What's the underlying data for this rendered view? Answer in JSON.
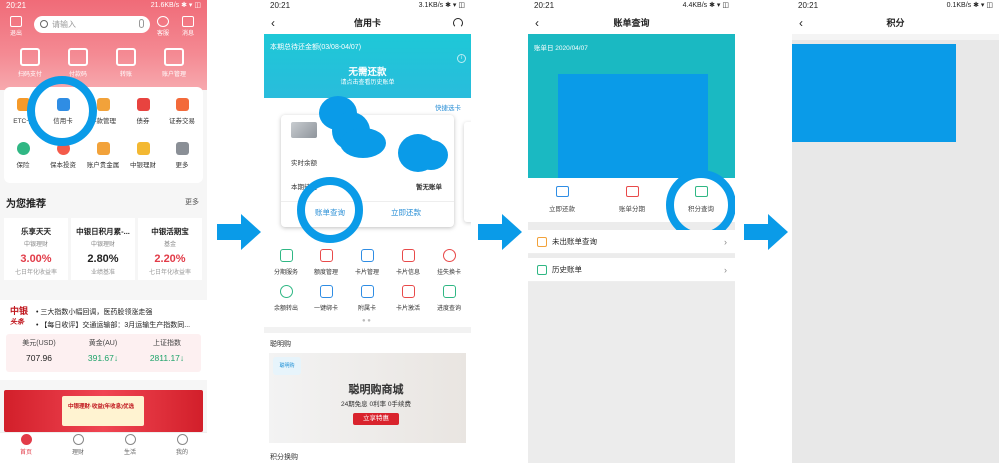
{
  "screen1": {
    "status": {
      "time": "20:21",
      "right": "21.6KB/s ✱ ▾ ◫"
    },
    "top_icons": [
      {
        "label": "退出"
      },
      {
        "label": "客服"
      },
      {
        "label": "消息"
      }
    ],
    "search_placeholder": "请输入",
    "quick": [
      {
        "label": "扫码支付"
      },
      {
        "label": "付款码"
      },
      {
        "label": "转账"
      },
      {
        "label": "账户管理"
      }
    ],
    "menu": [
      {
        "label": "ETC卡",
        "color": "#f59a2a"
      },
      {
        "label": "信用卡",
        "color": "#2f8de4"
      },
      {
        "label": "存款管理",
        "color": "#f2a23a"
      },
      {
        "label": "债券",
        "color": "#e8433f"
      },
      {
        "label": "证券交易",
        "color": "#f36a3a"
      },
      {
        "label": "保险",
        "color": "#30b784"
      },
      {
        "label": "保本投资",
        "color": "#f45a4a"
      },
      {
        "label": "账户贵金属",
        "color": "#f2a23a"
      },
      {
        "label": "中银理财",
        "color": "#f3b832"
      },
      {
        "label": "更多",
        "color": "#8a8f96"
      }
    ],
    "reco_title": "为您推荐",
    "reco_more": "更多",
    "reco": [
      {
        "title": "乐享天天",
        "sub": "中银理财",
        "value": "3.00%",
        "desc": "七日年化收益率"
      },
      {
        "title": "中银日积月累-...",
        "sub": "中银理财",
        "value": "2.80%",
        "desc": "业绩基准"
      },
      {
        "title": "中银活期宝",
        "sub": "基金",
        "value": "2.20%",
        "desc": "七日年化收益率"
      }
    ],
    "news_logo": "中银",
    "news_logo_sub": "头条",
    "news": [
      "• 三大指数小幅回调，医药股领涨走强",
      "• 【每日收评】交通运输部：3月运输生产指数同..."
    ],
    "rates": [
      {
        "name": "美元(USD)",
        "value": "707.96",
        "color": "#222222"
      },
      {
        "name": "黄金(AU)",
        "value": "391.67↓",
        "color": "#1ea36a"
      },
      {
        "name": "上证指数",
        "value": "2811.17↓",
        "color": "#1ea36a"
      }
    ],
    "banner_title": "中银理财·收益(年收息)优选",
    "tabs": [
      {
        "label": "首页"
      },
      {
        "label": "理财"
      },
      {
        "label": "生活"
      },
      {
        "label": "我的"
      }
    ]
  },
  "screen2": {
    "status": {
      "time": "20:21",
      "right": "3.1KB/s ✱ ▾ ◫"
    },
    "nav_title": "信用卡",
    "hero_label": "本期总待还金额(03/08-04/07)",
    "hero_big": "无需还款",
    "hero_small": "请点击查看历史账单",
    "quick_card": "快捷选卡",
    "card_avail": "实时余额",
    "card_bill": "本期待还",
    "card_none": "暂无账单",
    "btn_query": "账单查询",
    "btn_pay": "立即还款",
    "icons": [
      {
        "label": "分期服务",
        "color": "#2fb784"
      },
      {
        "label": "额度管理",
        "color": "#e84a4a"
      },
      {
        "label": "卡片管理",
        "color": "#2f8de4"
      },
      {
        "label": "卡片信息",
        "color": "#e84a4a"
      },
      {
        "label": "挂失换卡",
        "color": "#e84a4a"
      },
      {
        "label": "余额转出",
        "color": "#2fb784"
      },
      {
        "label": "一键绑卡",
        "color": "#2f8de4"
      },
      {
        "label": "附属卡",
        "color": "#2f8de4"
      },
      {
        "label": "卡片激活",
        "color": "#e84a4a"
      },
      {
        "label": "进度查询",
        "color": "#2fb784"
      }
    ],
    "section1": "聪明购",
    "ad_logo": "聪明购",
    "ad_head": "聪明购商城",
    "ad_sub": "24期免息 0利率 0手续费",
    "ad_cta": "立享特惠",
    "section2": "积分换购"
  },
  "screen3": {
    "status": {
      "time": "20:21",
      "right": "4.4KB/s ✱ ▾ ◫"
    },
    "nav_title": "账单查询",
    "bill_date": "账单日 2020/04/07",
    "actions": [
      {
        "label": "立即还款",
        "color": "#2f8de4"
      },
      {
        "label": "账单分期",
        "color": "#e84a4a"
      },
      {
        "label": "积分查询",
        "color": "#2fb784"
      }
    ],
    "rows": [
      {
        "label": "未出账单查询",
        "color": "#f2a23a"
      },
      {
        "label": "历史账单",
        "color": "#2fb784"
      }
    ]
  },
  "screen4": {
    "status": {
      "time": "20:21",
      "right": "0.1KB/s ✱ ▾ ◫"
    },
    "nav_title": "积分"
  }
}
